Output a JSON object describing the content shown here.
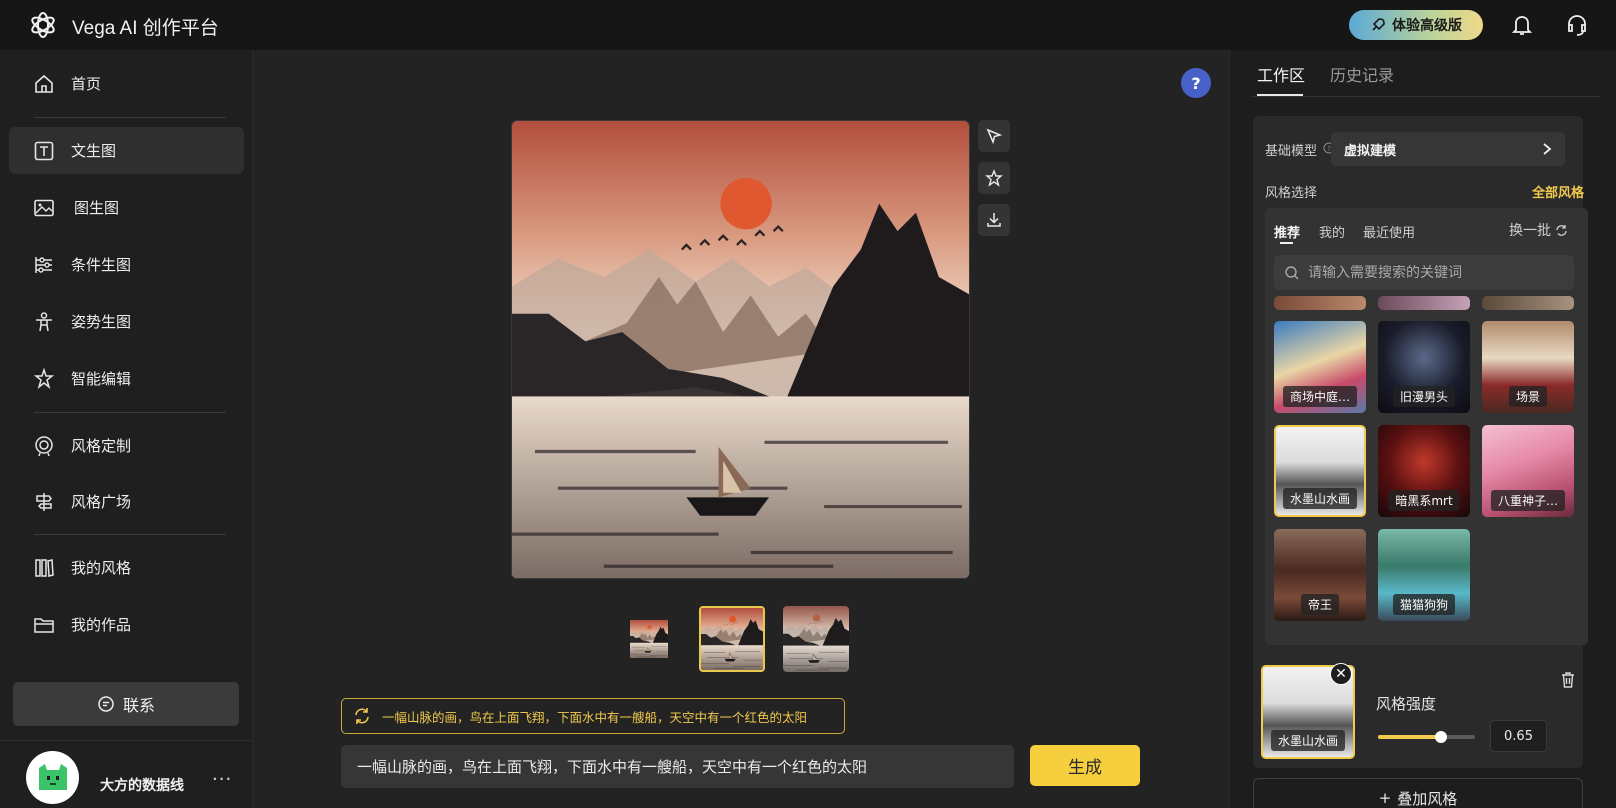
{
  "app": {
    "title": "Vega AI 创作平台",
    "upgrade_label": "体验高级版"
  },
  "sidebar": {
    "items": [
      {
        "label": "首页",
        "icon": "home-icon"
      },
      {
        "label": "文生图",
        "icon": "text-icon"
      },
      {
        "label": "图生图",
        "icon": "image-icon"
      },
      {
        "label": "条件生图",
        "icon": "sliders-icon"
      },
      {
        "label": "姿势生图",
        "icon": "pose-icon"
      },
      {
        "label": "智能编辑",
        "icon": "magic-icon"
      },
      {
        "label": "风格定制",
        "icon": "target-icon"
      },
      {
        "label": "风格广场",
        "icon": "signpost-icon"
      },
      {
        "label": "我的风格",
        "icon": "books-icon"
      },
      {
        "label": "我的作品",
        "icon": "folder-icon"
      }
    ],
    "active_index": 1,
    "contact_label": "联系",
    "user_name": "大方的数据线",
    "more_label": "···"
  },
  "main": {
    "help_label": "?",
    "prompt_hint": "一幅山脉的画，鸟在上面飞翔，下面水中有一艘船，天空中有一个红色的太阳",
    "prompt_value": "一幅山脉的画，鸟在上面飞翔，下面水中有一艘船，天空中有一个红色的太阳",
    "generate_label": "生成",
    "selected_thumb": 1
  },
  "right_panel": {
    "tabs": [
      "工作区",
      "历史记录"
    ],
    "base_model_label": "基础模型",
    "base_model_value": "虚拟建模",
    "style_select_label": "风格选择",
    "all_styles_label": "全部风格",
    "style_tabs": [
      "推荐",
      "我的",
      "最近使用"
    ],
    "refresh_label": "换一批",
    "search_placeholder": "请输入需要搜索的关键词",
    "style_tiles": [
      {
        "label": "商场中庭…"
      },
      {
        "label": "旧漫男头"
      },
      {
        "label": "场景"
      },
      {
        "label": "水墨山水画"
      },
      {
        "label": "暗黑系mrt"
      },
      {
        "label": "八重神子…"
      },
      {
        "label": "帝王"
      },
      {
        "label": "猫猫狗狗"
      }
    ],
    "applied_style": {
      "label": "水墨山水画",
      "strength_label": "风格强度",
      "strength_value": "0.65",
      "strength": 0.65
    },
    "add_style_label": "叠加风格"
  },
  "colors": {
    "accent": "#f1c94c",
    "background": "#232323",
    "upgrade_gradient_start": "#5aa9d6"
  }
}
